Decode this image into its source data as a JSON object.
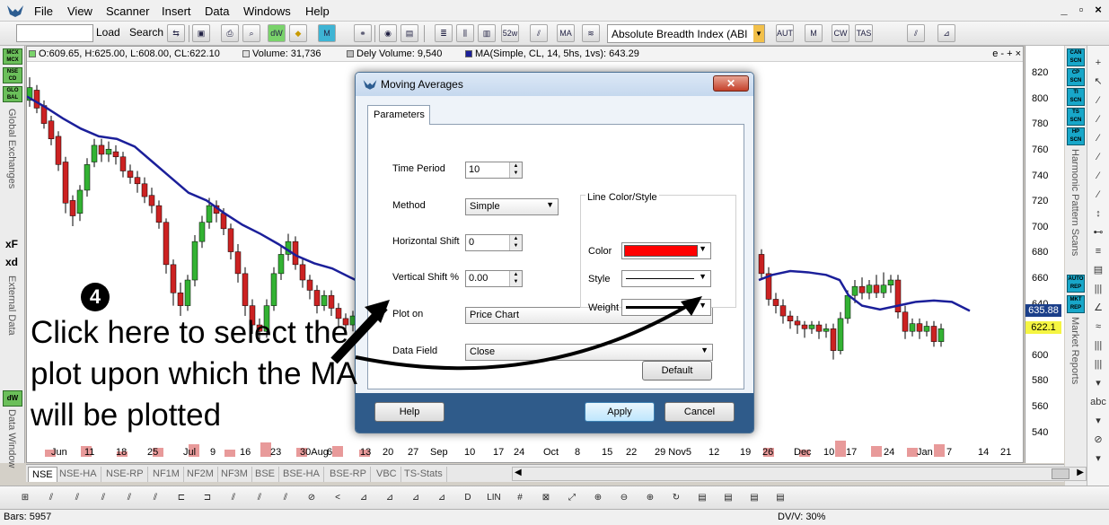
{
  "menubar": {
    "items": [
      "File",
      "View",
      "Scanner",
      "Insert",
      "Data",
      "Windows",
      "Help"
    ],
    "window_controls": [
      "_",
      "▫",
      "×"
    ]
  },
  "toolbar": {
    "load_label": "Load",
    "search_label": "Search",
    "indicator_value": "Absolute Breadth Index (ABI",
    "icon_labels": [
      "dW",
      "M",
      "52w",
      "MA",
      "AUTO",
      "M PVT",
      "CW TAM",
      "TAS"
    ]
  },
  "left_panel": {
    "badges": [
      "MCX MCX",
      "NSE CD",
      "GLO BAL"
    ],
    "global_exchanges_label": "Global Exchanges",
    "external_data_label": "External Data",
    "data_window_label": "Data Window",
    "xf_label": "xF",
    "xd_label": "xd",
    "dw_label": "dW"
  },
  "info_bar": {
    "ohlc": "O:609.65, H:625.00, L:608.00, CL:622.10",
    "volume": "Volume: 31,736",
    "dely_volume": "Dely Volume: 9,540",
    "ma": "MA(Simple, CL, 14, 5hs, 1vs): 643.29",
    "zoom_controls": "e - + ×"
  },
  "colors": {
    "candle_up": "#33b233",
    "candle_down": "#cc2222",
    "ma_line": "#1b1f9a",
    "volume_bar": "#e89a9a",
    "price_tag_current": "#1b3f8a",
    "price_tag_close": "#f5f542"
  },
  "chart_data": {
    "type": "candlestick",
    "y_ticks": [
      820,
      800,
      780,
      760,
      740,
      720,
      700,
      680,
      660,
      640,
      620,
      600,
      580,
      560,
      540
    ],
    "ylim": [
      532,
      830
    ],
    "x_ticks": [
      "Jun",
      "11",
      "18",
      "25",
      "Jul",
      "9",
      "16",
      "23",
      "30Aug",
      "6",
      "13",
      "20",
      "27",
      "Sep",
      "10",
      "17",
      "24",
      "Oct",
      "8",
      "15",
      "22",
      "29 Nov5",
      "12",
      "19",
      "26",
      "Dec",
      "10",
      "17",
      "24",
      "Jan",
      "7",
      "14",
      "21"
    ],
    "current_price_tag": "635.88",
    "close_price_tag": "622.1",
    "ma_series": [
      [
        0,
        803
      ],
      [
        20,
        795
      ],
      [
        40,
        786
      ],
      [
        60,
        778
      ],
      [
        80,
        772
      ],
      [
        100,
        770
      ],
      [
        120,
        764
      ],
      [
        140,
        752
      ],
      [
        160,
        740
      ],
      [
        180,
        728
      ],
      [
        200,
        722
      ],
      [
        220,
        712
      ],
      [
        240,
        703
      ],
      [
        260,
        696
      ],
      [
        280,
        688
      ],
      [
        300,
        679
      ],
      [
        320,
        673
      ],
      [
        340,
        669
      ],
      [
        360,
        662
      ],
      [
        375,
        657
      ],
      [
        815,
        660
      ],
      [
        830,
        664
      ],
      [
        850,
        667
      ],
      [
        870,
        666
      ],
      [
        890,
        664
      ],
      [
        905,
        660
      ],
      [
        915,
        648
      ],
      [
        930,
        640
      ],
      [
        950,
        637
      ],
      [
        970,
        640
      ],
      [
        990,
        643
      ],
      [
        1010,
        644
      ],
      [
        1030,
        643
      ],
      [
        1050,
        636
      ]
    ],
    "candles": [
      [
        0,
        800,
        810,
        795,
        818
      ],
      [
        8,
        808,
        794,
        790,
        812
      ],
      [
        16,
        796,
        782,
        778,
        800
      ],
      [
        24,
        784,
        770,
        765,
        788
      ],
      [
        32,
        772,
        750,
        745,
        776
      ],
      [
        40,
        752,
        720,
        712,
        756
      ],
      [
        48,
        722,
        710,
        702,
        726
      ],
      [
        56,
        712,
        730,
        706,
        734
      ],
      [
        64,
        730,
        750,
        725,
        755
      ],
      [
        72,
        752,
        765,
        748,
        770
      ],
      [
        80,
        765,
        758,
        752,
        770
      ],
      [
        88,
        758,
        762,
        752,
        768
      ],
      [
        96,
        760,
        756,
        750,
        765
      ],
      [
        104,
        756,
        745,
        740,
        760
      ],
      [
        112,
        745,
        740,
        735,
        750
      ],
      [
        120,
        740,
        735,
        728,
        745
      ],
      [
        128,
        735,
        725,
        720,
        740
      ],
      [
        136,
        726,
        718,
        712,
        732
      ],
      [
        144,
        718,
        705,
        700,
        722
      ],
      [
        152,
        705,
        672,
        665,
        708
      ],
      [
        160,
        672,
        650,
        640,
        676
      ],
      [
        168,
        650,
        640,
        632,
        658
      ],
      [
        176,
        640,
        660,
        636,
        664
      ],
      [
        184,
        660,
        690,
        655,
        695
      ],
      [
        192,
        690,
        705,
        685,
        710
      ],
      [
        200,
        705,
        718,
        700,
        724
      ],
      [
        208,
        718,
        712,
        705,
        722
      ],
      [
        216,
        712,
        700,
        695,
        716
      ],
      [
        224,
        700,
        682,
        676,
        704
      ],
      [
        232,
        682,
        665,
        658,
        688
      ],
      [
        240,
        665,
        640,
        632,
        670
      ],
      [
        248,
        640,
        625,
        618,
        645
      ],
      [
        256,
        625,
        620,
        612,
        630
      ],
      [
        264,
        620,
        640,
        615,
        645
      ],
      [
        272,
        640,
        665,
        636,
        670
      ],
      [
        280,
        665,
        680,
        660,
        686
      ],
      [
        288,
        680,
        690,
        675,
        696
      ],
      [
        296,
        690,
        672,
        668,
        694
      ],
      [
        304,
        672,
        660,
        654,
        676
      ],
      [
        312,
        660,
        652,
        645,
        664
      ],
      [
        320,
        652,
        640,
        634,
        656
      ],
      [
        328,
        640,
        648,
        636,
        652
      ],
      [
        336,
        648,
        638,
        632,
        652
      ],
      [
        344,
        638,
        630,
        624,
        642
      ],
      [
        352,
        630,
        625,
        618,
        634
      ],
      [
        360,
        625,
        632,
        620,
        636
      ],
      [
        368,
        632,
        628,
        622,
        638
      ],
      [
        815,
        680,
        665,
        660,
        684
      ],
      [
        823,
        665,
        645,
        640,
        670
      ],
      [
        831,
        645,
        640,
        634,
        650
      ],
      [
        839,
        640,
        632,
        626,
        645
      ],
      [
        847,
        632,
        628,
        622,
        636
      ],
      [
        855,
        628,
        625,
        618,
        632
      ],
      [
        863,
        625,
        622,
        615,
        628
      ],
      [
        871,
        622,
        625,
        618,
        628
      ],
      [
        879,
        625,
        620,
        614,
        628
      ],
      [
        887,
        620,
        622,
        615,
        626
      ],
      [
        895,
        622,
        605,
        598,
        626
      ],
      [
        903,
        605,
        630,
        602,
        635
      ],
      [
        911,
        630,
        648,
        626,
        652
      ],
      [
        919,
        648,
        655,
        642,
        660
      ],
      [
        927,
        655,
        650,
        645,
        662
      ],
      [
        935,
        650,
        656,
        645,
        660
      ],
      [
        943,
        656,
        650,
        646,
        664
      ],
      [
        951,
        650,
        656,
        646,
        666
      ],
      [
        959,
        656,
        660,
        650,
        664
      ],
      [
        967,
        660,
        635,
        630,
        664
      ],
      [
        975,
        635,
        620,
        614,
        640
      ],
      [
        983,
        620,
        626,
        616,
        630
      ],
      [
        991,
        626,
        620,
        614,
        630
      ],
      [
        999,
        620,
        624,
        616,
        628
      ],
      [
        1007,
        624,
        612,
        608,
        628
      ],
      [
        1015,
        612,
        622,
        608,
        626
      ]
    ],
    "volume_bars": [
      [
        20,
        4
      ],
      [
        60,
        6
      ],
      [
        100,
        3
      ],
      [
        140,
        5
      ],
      [
        180,
        7
      ],
      [
        220,
        4
      ],
      [
        260,
        8
      ],
      [
        300,
        5
      ],
      [
        340,
        6
      ],
      [
        370,
        4
      ],
      [
        820,
        5
      ],
      [
        860,
        4
      ],
      [
        900,
        9
      ],
      [
        940,
        6
      ],
      [
        980,
        5
      ],
      [
        1010,
        7
      ]
    ]
  },
  "right_panel": {
    "scan_badges": [
      "CAN SCN",
      "CP SCN",
      "TI SCN",
      "TS SCN",
      "HP SCN"
    ],
    "report_badges": [
      "AUTO REP",
      "MKT REP"
    ],
    "harmonic_label": "Harmonic Pattern Scans",
    "market_reports_label": "Market Reports"
  },
  "tools_panel": {
    "icons": [
      "+",
      "↖",
      "⁄",
      "⁄",
      "⁄",
      "⁄",
      "⁄",
      "⁄",
      "↕",
      "⊷",
      "≡",
      "▤",
      "|||",
      "∠",
      "≈",
      "|||",
      "|||",
      "▾",
      "abc",
      "▾",
      "⊘",
      "▾"
    ]
  },
  "exchange_tabs": [
    "NSE",
    "NSE-HA",
    "NSE-RP",
    "NF1M",
    "NF2M",
    "NF3M",
    "BSE",
    "BSE-HA",
    "BSE-RP",
    "VBC",
    "TS-Stats"
  ],
  "drawing_toolbar": {
    "icons": [
      "⊞",
      "⫽",
      "⫽",
      "⫽",
      "⫽",
      "⫽",
      "⊏",
      "⊐",
      "⫽",
      "⫽",
      "⫽",
      "⊘",
      "<",
      "⊿",
      "⊿",
      "⊿",
      "⊿",
      "D",
      "LIN",
      "#",
      "⊠",
      "⤢",
      "⊕",
      "⊖",
      "⊕",
      "↻",
      "▤",
      "▤",
      "▤",
      "▤"
    ]
  },
  "statusbar": {
    "bars": "Bars: 5957",
    "dv": "DV/V: 30%"
  },
  "dialog": {
    "title": "Moving Averages",
    "close_label": "✕",
    "tab_label": "Parameters",
    "time_period_label": "Time Period",
    "time_period_value": "10",
    "method_label": "Method",
    "method_value": "Simple",
    "horizontal_shift_label": "Horizontal Shift",
    "horizontal_shift_value": "0",
    "vertical_shift_label": "Vertical Shift %",
    "vertical_shift_value": "0.00",
    "plot_on_label": "Plot on",
    "plot_on_value": "Price Chart",
    "data_field_label": "Data Field",
    "data_field_value": "Close",
    "line_group_label": "Line Color/Style",
    "color_label": "Color",
    "color_value": "#ff0000",
    "style_label": "Style",
    "weight_label": "Weight",
    "default_button": "Default",
    "help_button": "Help",
    "apply_button": "Apply",
    "cancel_button": "Cancel"
  },
  "annotation": {
    "step_number": "4",
    "instruction": "Click here to select the plot upon which the MA will be plotted"
  }
}
